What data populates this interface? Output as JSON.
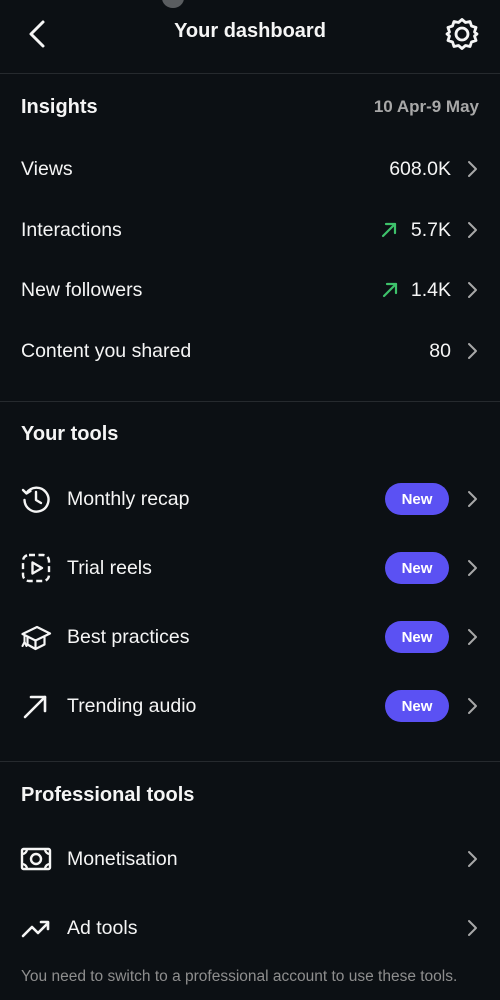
{
  "header": {
    "title": "Your dashboard",
    "back_icon": "chevron-left-icon",
    "settings_icon": "gear-icon"
  },
  "insights": {
    "title": "Insights",
    "date_range": "10 Apr-9 May",
    "rows": [
      {
        "label": "Views",
        "value": "608.0K",
        "trend": null
      },
      {
        "label": "Interactions",
        "value": "5.7K",
        "trend": "up"
      },
      {
        "label": "New followers",
        "value": "1.4K",
        "trend": "up"
      },
      {
        "label": "Content you shared",
        "value": "80",
        "trend": null
      }
    ]
  },
  "your_tools": {
    "title": "Your tools",
    "items": [
      {
        "label": "Monthly recap",
        "badge": "New",
        "icon": "history-icon"
      },
      {
        "label": "Trial reels",
        "badge": "New",
        "icon": "reel-play-icon"
      },
      {
        "label": "Best practices",
        "badge": "New",
        "icon": "graduation-cap-icon"
      },
      {
        "label": "Trending audio",
        "badge": "New",
        "icon": "arrow-up-right-icon"
      }
    ]
  },
  "professional_tools": {
    "title": "Professional tools",
    "items": [
      {
        "label": "Monetisation",
        "icon": "money-icon"
      },
      {
        "label": "Ad tools",
        "icon": "trending-up-icon"
      }
    ],
    "footnote": "You need to switch to a professional account to use these tools."
  },
  "colors": {
    "background": "#0c1014",
    "accent_badge": "#5b51f3",
    "trend_up": "#3ec26b",
    "muted_text": "#a8a8a8"
  }
}
